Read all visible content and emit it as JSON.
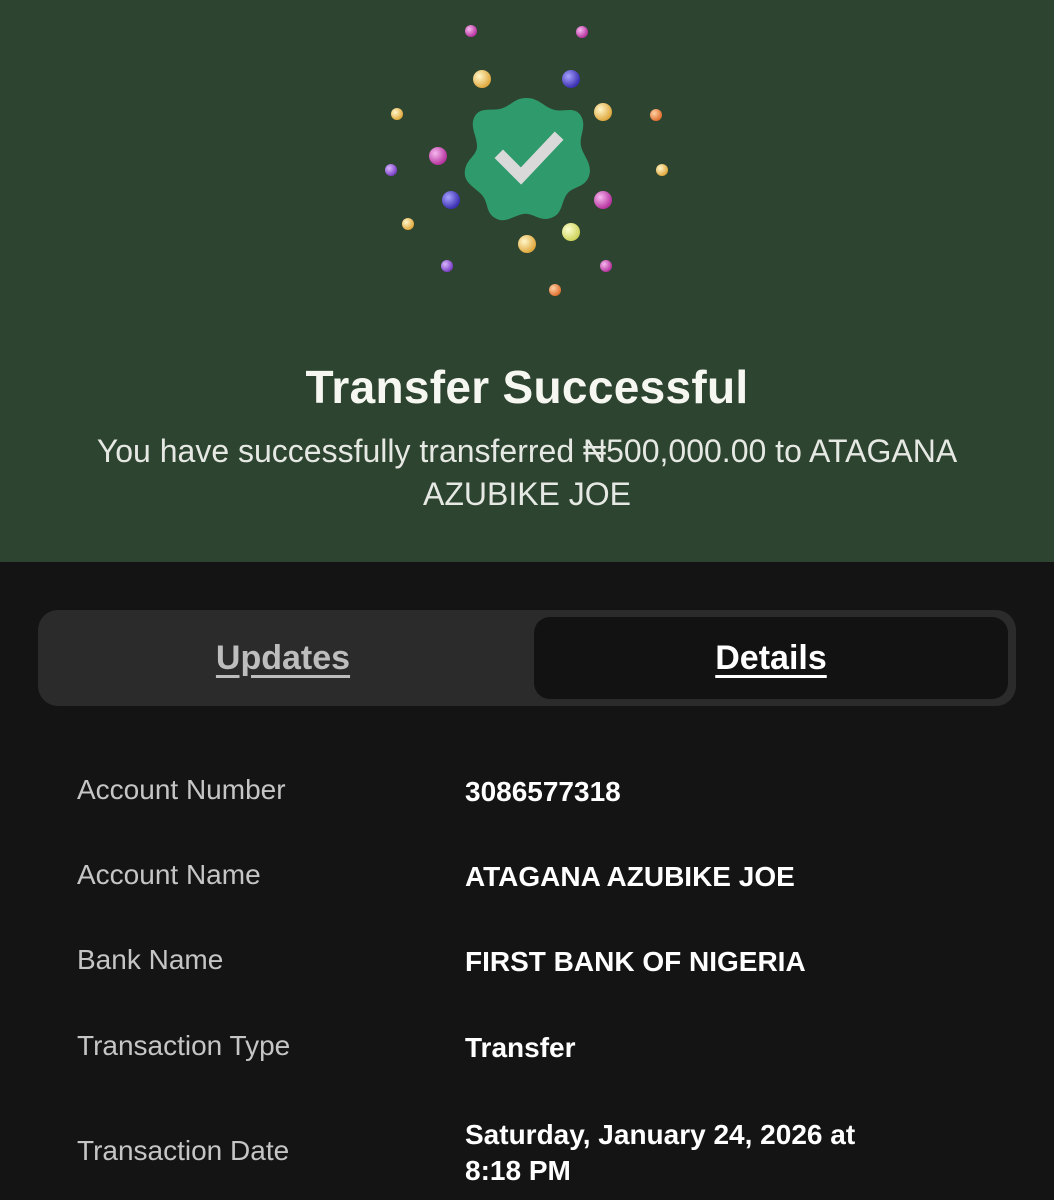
{
  "header": {
    "title": "Transfer Successful",
    "message": "You have successfully transferred ₦500,000.00 to ATAGANA AZUBIKE JOE"
  },
  "tabs": [
    {
      "label": "Updates",
      "selected": false
    },
    {
      "label": "Details",
      "selected": true
    }
  ],
  "details": [
    {
      "label": "Account Number",
      "value": "3086577318"
    },
    {
      "label": "Account Name",
      "value": "ATAGANA AZUBIKE JOE"
    },
    {
      "label": "Bank Name",
      "value": "FIRST BANK OF NIGERIA"
    },
    {
      "label": "Transaction Type",
      "value": "Transfer"
    },
    {
      "label": "Transaction Date",
      "value": "Saturday, January 24, 2026 at 8:18 PM"
    }
  ],
  "colors": {
    "hero_bg": "#2d4430",
    "badge": "#2f9a6c",
    "page_bg": "#141414"
  },
  "icons": {
    "badge": "check-badge-icon"
  }
}
